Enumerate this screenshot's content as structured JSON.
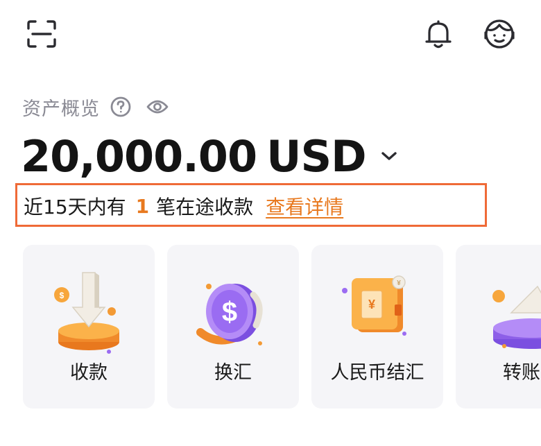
{
  "header": {
    "scan_icon": "scan-icon",
    "bell_icon": "bell-icon",
    "service_icon": "customer-service-icon"
  },
  "asset": {
    "label": "资产概览",
    "help_icon": "help-circle-icon",
    "eye_icon": "eye-icon",
    "amount": "20,000.00",
    "currency": "USD",
    "dropdown_icon": "chevron-down-icon"
  },
  "transit": {
    "prefix": "近15天内有",
    "count": "1",
    "suffix": "笔在途收款",
    "link_label": "查看详情"
  },
  "actions": [
    {
      "label": "收款",
      "icon": "receive-coin-icon"
    },
    {
      "label": "换汇",
      "icon": "exchange-coin-icon"
    },
    {
      "label": "人民币结汇",
      "icon": "rmb-settlement-icon"
    },
    {
      "label": "转账",
      "icon": "transfer-icon"
    }
  ],
  "colors": {
    "accent": "#e8791f",
    "highlight_border": "#ef6a37",
    "card_bg": "#f5f5f8",
    "muted_text": "#8a8a94"
  }
}
